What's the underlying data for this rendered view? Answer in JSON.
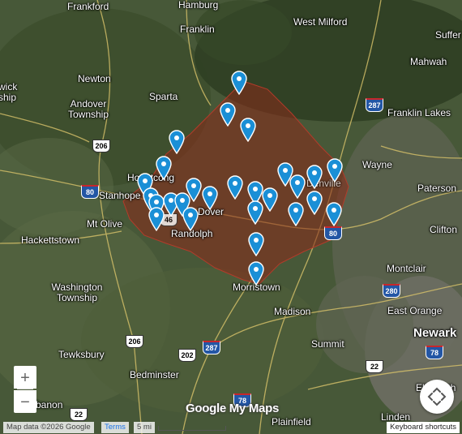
{
  "map": {
    "type": "satellite",
    "places": [
      {
        "name": "Frankford"
      },
      {
        "name": "Hamburg"
      },
      {
        "name": "Franklin"
      },
      {
        "name": "West Milford"
      },
      {
        "name": "Suffer"
      },
      {
        "name": "Mahwah"
      },
      {
        "name": "Newton"
      },
      {
        "name": "Sparta"
      },
      {
        "name": "Andover Township"
      },
      {
        "name": "Franklin Lakes"
      },
      {
        "name": "wick ship"
      },
      {
        "name": "Wayne"
      },
      {
        "name": "Hopatcong"
      },
      {
        "name": "Stanhope"
      },
      {
        "name": "Paterson"
      },
      {
        "name": "Mt Olive"
      },
      {
        "name": "Dover"
      },
      {
        "name": "Denville"
      },
      {
        "name": "Randolph"
      },
      {
        "name": "Hackettstown"
      },
      {
        "name": "Clifton"
      },
      {
        "name": "Montclair"
      },
      {
        "name": "Washington Township"
      },
      {
        "name": "Morristown"
      },
      {
        "name": "Madison"
      },
      {
        "name": "East Orange"
      },
      {
        "name": "Newark"
      },
      {
        "name": "Summit"
      },
      {
        "name": "Tewksbury"
      },
      {
        "name": "Bedminster"
      },
      {
        "name": "Elizabeth"
      },
      {
        "name": "Plainfield"
      },
      {
        "name": "Linden"
      },
      {
        "name": "banon"
      }
    ],
    "shields": [
      {
        "label": "206",
        "kind": "us"
      },
      {
        "label": "287",
        "kind": "interstate"
      },
      {
        "label": "80",
        "kind": "interstate"
      },
      {
        "label": "80",
        "kind": "interstate"
      },
      {
        "label": "46",
        "kind": "us"
      },
      {
        "label": "280",
        "kind": "interstate"
      },
      {
        "label": "206",
        "kind": "us"
      },
      {
        "label": "202",
        "kind": "us"
      },
      {
        "label": "287",
        "kind": "interstate"
      },
      {
        "label": "22",
        "kind": "us"
      },
      {
        "label": "78",
        "kind": "interstate"
      },
      {
        "label": "22",
        "kind": "us"
      },
      {
        "label": "78",
        "kind": "interstate"
      }
    ],
    "region": {
      "fill": "#8b2a1a",
      "stroke": "#a33a2a",
      "opacity": 0.6
    },
    "markers_count": 31,
    "marker_color": "#1a8fd6"
  },
  "controls": {
    "zoom_in": "+",
    "zoom_out": "−",
    "logo": "Google My Maps"
  },
  "footer": {
    "attribution": "Map data ©2026 Google",
    "terms": "Terms",
    "scale": "5 mi",
    "keyboard": "Keyboard shortcuts"
  }
}
